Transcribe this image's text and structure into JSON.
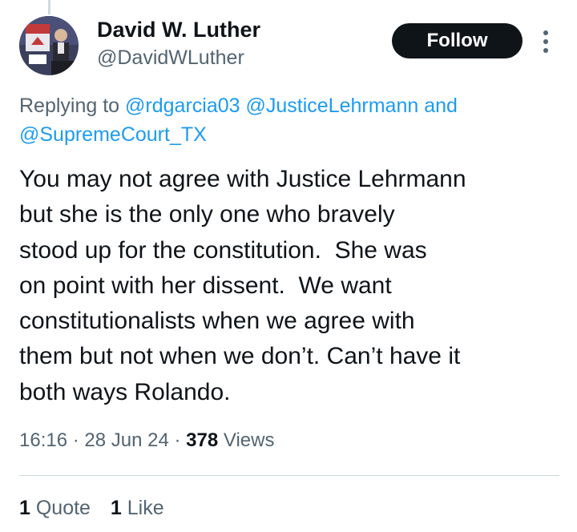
{
  "author": {
    "name": "David W. Luther",
    "handle": "@DavidWLuther"
  },
  "follow_label": "Follow",
  "reply": {
    "prefix": "Replying to",
    "mentions": [
      "@rdgarcia03",
      "@JusticeLehrmann"
    ],
    "connector": "and",
    "last_mention": "@SupremeCourt_TX"
  },
  "body_lines": [
    "You may not agree with Justice Lehrmann",
    "but she is the only one who bravely",
    "stood up for the constitution.  She was",
    "on point with her dissent.  We want",
    "constitutionalists when we agree with",
    "them but not when we don’t. Can’t have it",
    "both ways Rolando."
  ],
  "meta": {
    "time": "16:16",
    "date": "28 Jun 24",
    "views_count": "378",
    "views_label": "Views"
  },
  "stats": {
    "quotes_count": "1",
    "quotes_label": "Quote",
    "likes_count": "1",
    "likes_label": "Like"
  },
  "colors": {
    "link": "#1d9bf0",
    "secondary": "#536471",
    "primary": "#0f1419",
    "divider": "#cfd9de"
  }
}
